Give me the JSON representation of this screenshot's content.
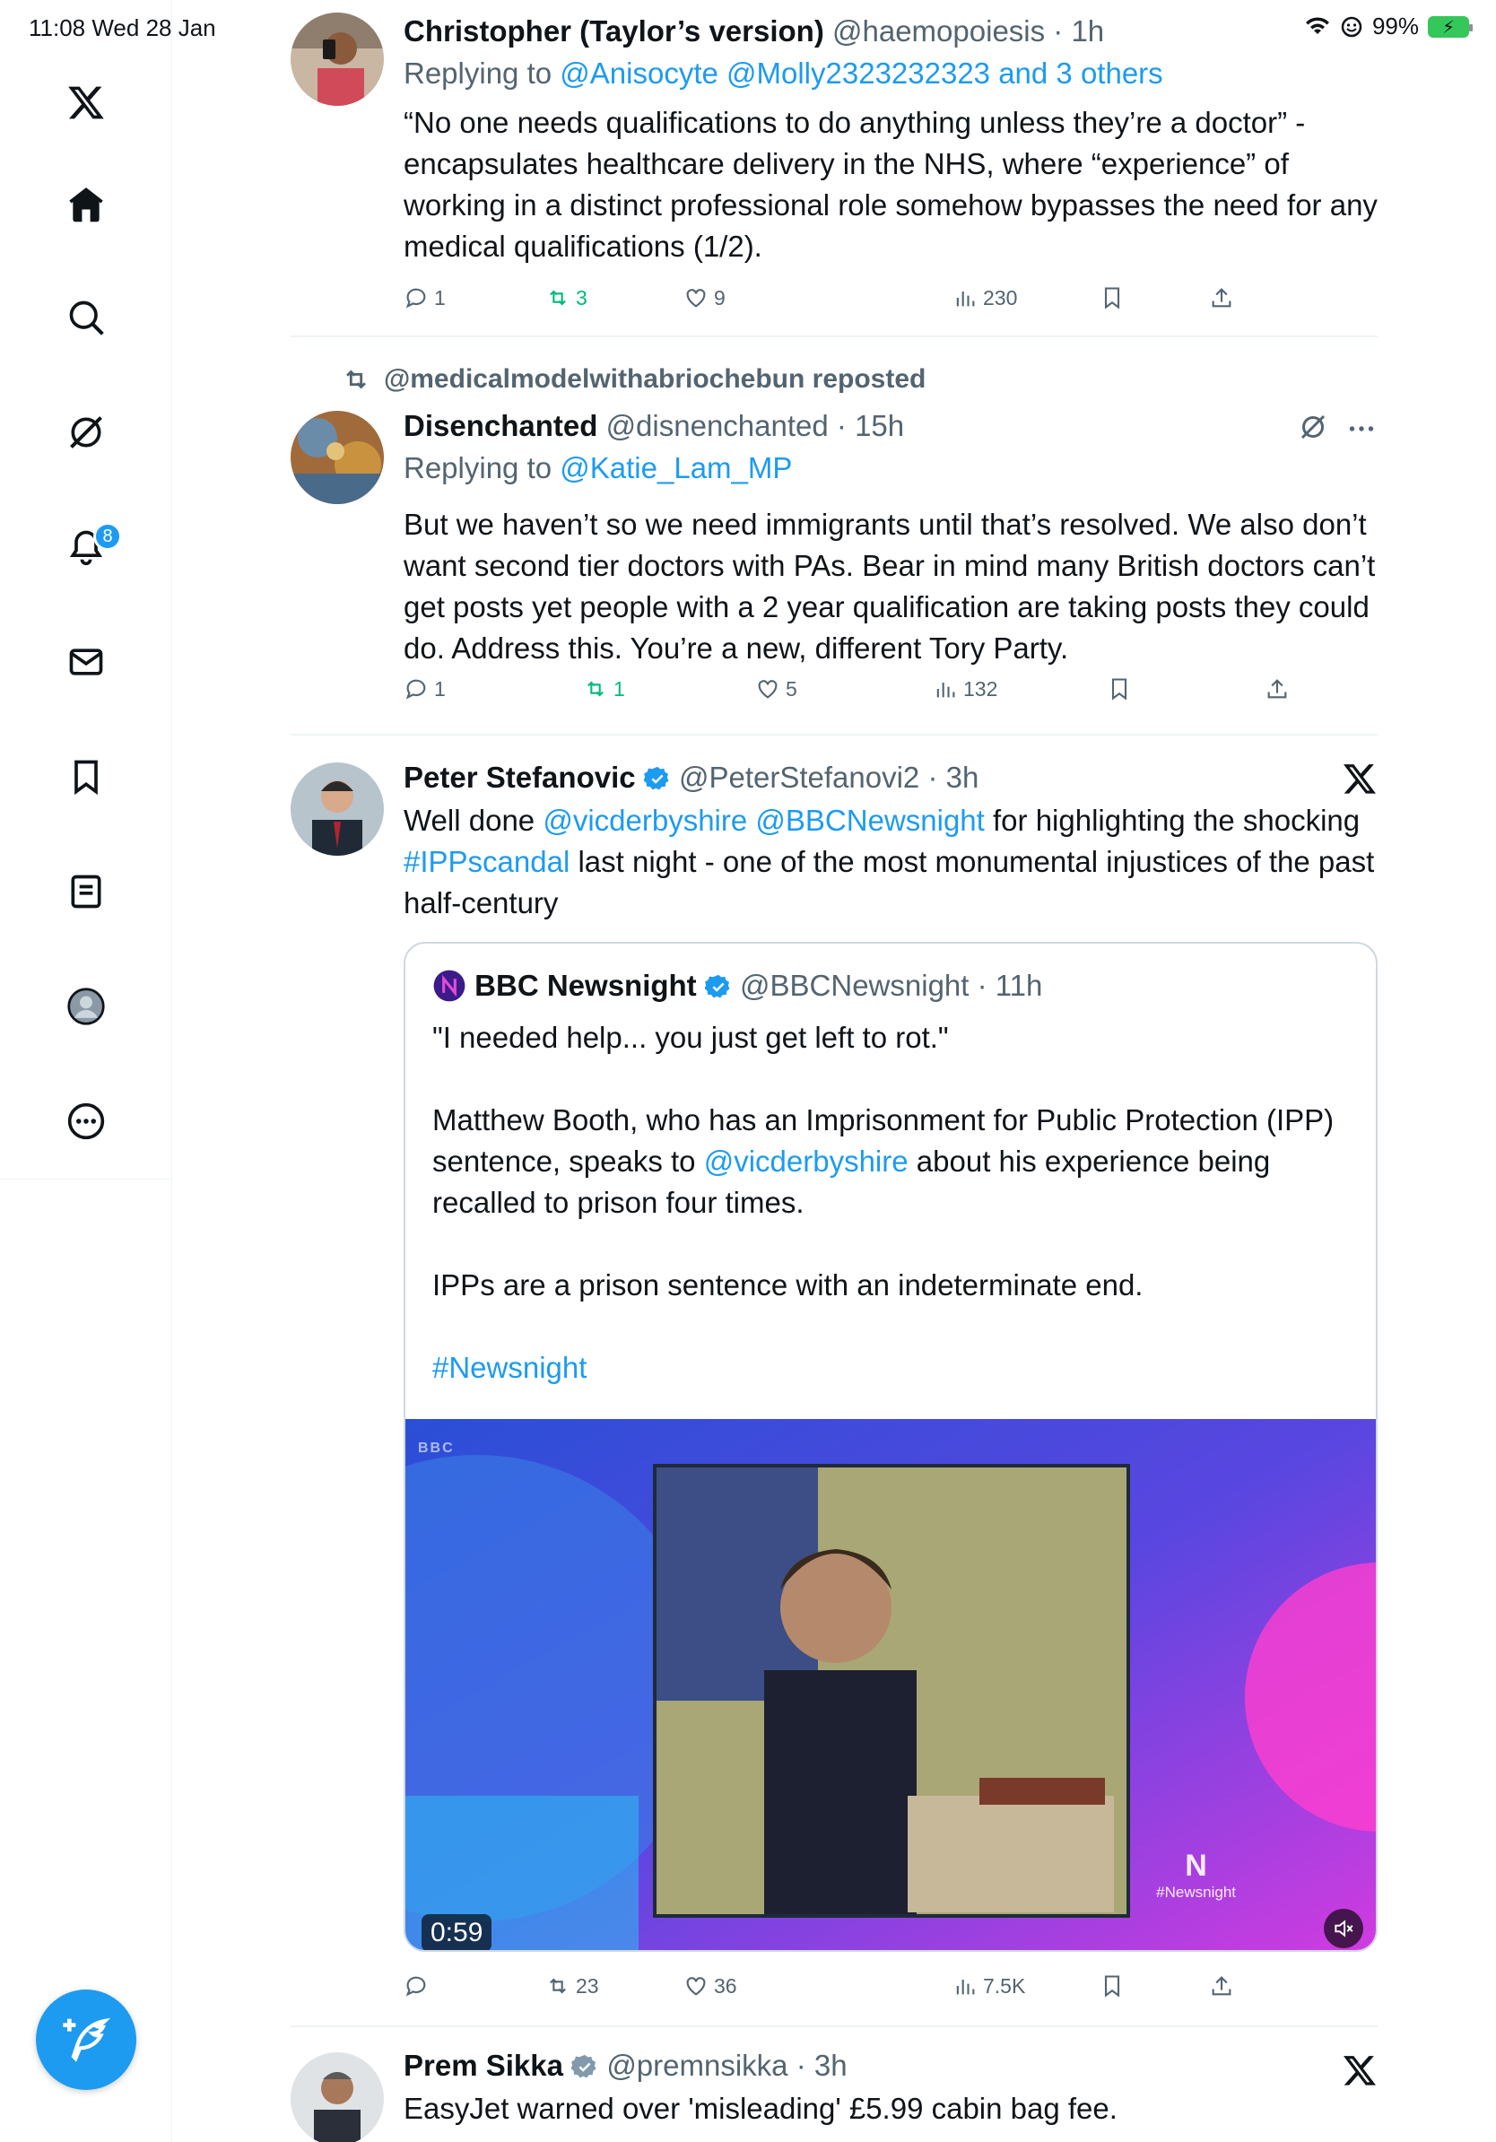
{
  "status": {
    "time": "11:08  Wed 28 Jan",
    "battery": "99%"
  },
  "sidebar": {
    "notifications_badge": "8",
    "items": [
      "x-logo",
      "home",
      "search",
      "grok",
      "notifications",
      "messages",
      "bookmarks",
      "lists",
      "profile",
      "more"
    ]
  },
  "tweets": [
    {
      "name": "Christopher (Taylor’s version)",
      "handle": "@haemopoiesis",
      "time": "· 1h",
      "replying_prefix": "Replying to ",
      "replying_to": "@Anisocyte @Molly2323232323 and 3 others",
      "text": "“No one needs qualifications to do anything unless they’re a doctor” - encapsulates healthcare delivery in the NHS, where “experience” of working in a distinct professional role somehow bypasses the need for any medical qualifications (1/2).",
      "replies": "1",
      "reposts": "3",
      "likes": "9",
      "views": "230"
    },
    {
      "reposted_by": "@medicalmodelwithabriochebun reposted",
      "name": "Disenchanted",
      "handle": "@disnenchanted",
      "time": "· 15h",
      "replying_prefix": "Replying to ",
      "replying_to": "@Katie_Lam_MP",
      "text": "But we haven’t so we need immigrants until that’s resolved. We also don’t want second tier doctors with PAs. Bear in mind many British doctors can’t get posts yet people with a 2 year qualification are taking posts they could do. Address this. You’re a new, different Tory Party.",
      "replies": "1",
      "reposts": "1",
      "likes": "5",
      "views": "132"
    },
    {
      "name": "Peter Stefanovic",
      "handle": "@PeterStefanovi2",
      "time": "· 3h",
      "text_parts": [
        "Well done ",
        "@vicderbyshire @BBCNewsnight",
        " for highlighting the shocking ",
        "#IPPscandal",
        " last night - one of the most monumental injustices of the past half-century"
      ],
      "quote": {
        "name": "BBC Newsnight",
        "handle": "@BBCNewsnight",
        "time": "· 11h",
        "para1": "\"I needed help... you just get left to rot.\"",
        "para2_a": "Matthew Booth, who has an Imprisonment for Public Protection (IPP) sentence, speaks to ",
        "para2_link": "@vicderbyshire",
        "para2_b": " about his experience being recalled to prison four times.",
        "para3": "IPPs are a prison sentence with an indeterminate end.",
        "hashtag": "#Newsnight",
        "video_duration": "0:59",
        "video_logo": "#Newsnight",
        "video_bbc": "BBC"
      },
      "replies": "",
      "reposts": "23",
      "likes": "36",
      "views": "7.5K"
    },
    {
      "name": "Prem Sikka",
      "handle": "@premnsikka",
      "time": "· 3h",
      "text": "EasyJet warned over 'misleading' £5.99 cabin bag fee."
    }
  ],
  "colors": {
    "accent": "#1d9bf0",
    "repost_green": "#00ba7c",
    "muted": "#536471",
    "text": "#0f1419"
  }
}
